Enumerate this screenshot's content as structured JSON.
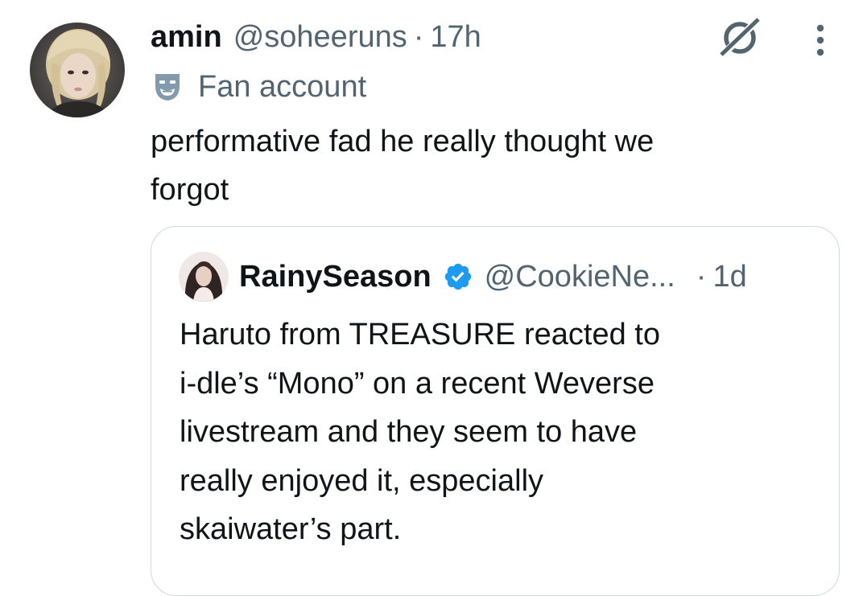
{
  "tweet": {
    "author_name": "amin",
    "author_handle": "@soheeruns",
    "separator": "·",
    "time": "17h",
    "label": "Fan account",
    "text": "performative fad he really thought we\nforgot",
    "avatar_icon": "user-avatar",
    "label_icon": "theater-mask-icon",
    "grok_icon": "grok-icon",
    "more_icon": "more-vertical-icon"
  },
  "quote": {
    "author_name": "RainySeason",
    "author_handle": "@CookieNe...",
    "separator": "·",
    "time": "1d",
    "verified_icon": "verified-badge-icon",
    "text": "Haruto from TREASURE reacted to\ni-dle’s “Mono” on a recent Weverse\nlivestream and they seem to have\nreally enjoyed it, especially\nskaiwater’s part."
  },
  "colors": {
    "primary_text": "#0f1419",
    "secondary_text": "#536471",
    "border": "#cfd9de",
    "verified_blue": "#1d9bf0",
    "label_icon": "#829aab"
  }
}
